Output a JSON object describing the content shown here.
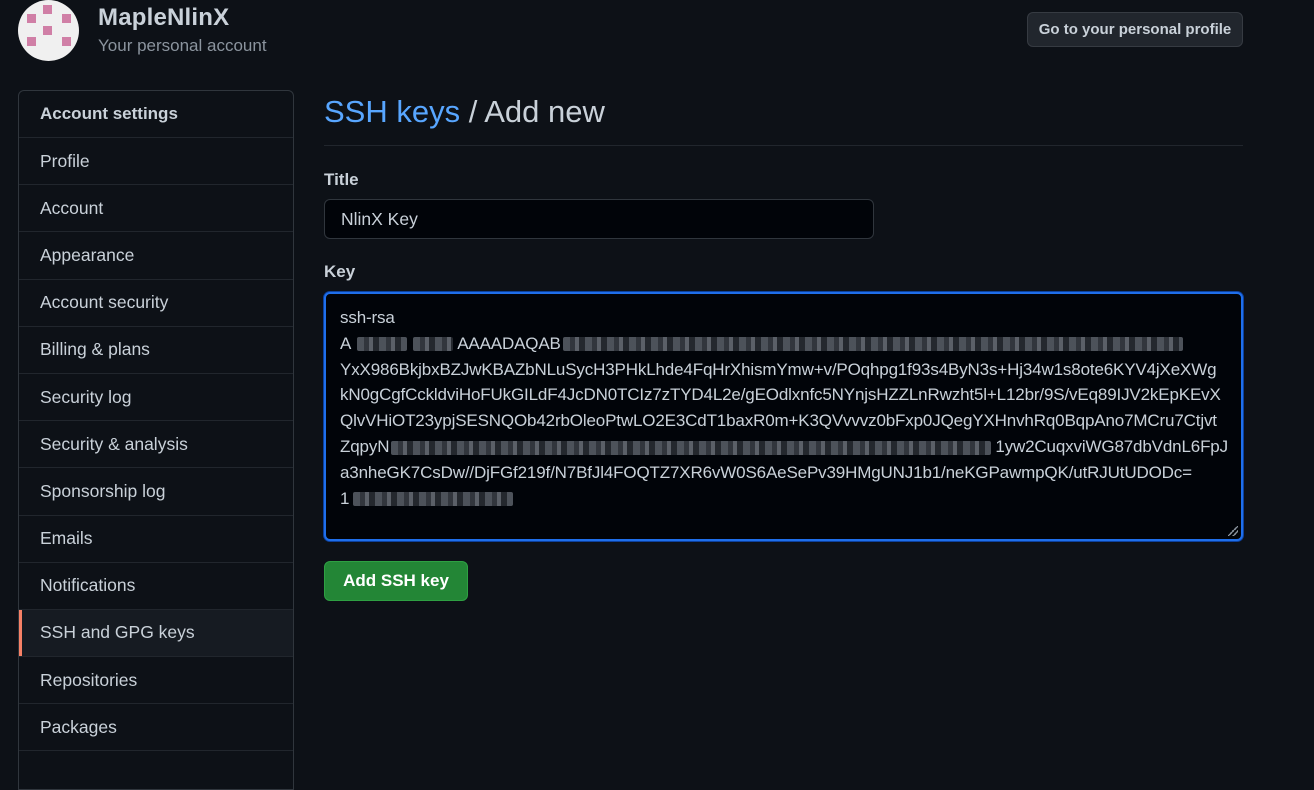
{
  "header": {
    "account_name": "MapleNlinX",
    "account_subtitle": "Your personal account",
    "profile_button": "Go to your personal profile"
  },
  "sidebar": {
    "heading": "Account settings",
    "items": [
      {
        "label": "Profile"
      },
      {
        "label": "Account"
      },
      {
        "label": "Appearance"
      },
      {
        "label": "Account security"
      },
      {
        "label": "Billing & plans"
      },
      {
        "label": "Security log"
      },
      {
        "label": "Security & analysis"
      },
      {
        "label": "Sponsorship log"
      },
      {
        "label": "Emails"
      },
      {
        "label": "Notifications"
      },
      {
        "label": "SSH and GPG keys",
        "active": true
      },
      {
        "label": "Repositories"
      },
      {
        "label": "Packages"
      }
    ]
  },
  "main": {
    "breadcrumb_link": "SSH keys",
    "breadcrumb_separator": " / ",
    "breadcrumb_current": "Add new",
    "title_label": "Title",
    "title_value": "NlinX Key",
    "key_label": "Key",
    "key_lines": [
      "ssh-rsa",
      "A",
      "AAAADAQAB",
      "YxX986BkjbxBZJwKBAZbNLuSycH3PHkLhde4FqHrXhismYmw+v/POqhpg1f93s4ByN3s+Hj34w1s8ote6KYV4jXeXWg",
      "kN0gCgfCckldviHoFUkGILdF4JcDN0TCIz7zTYD4L2e/gEOdlxnfc5NYnjsHZZLnRwzht5l+L12br/9S/vEq89IJV2kEpKEvX",
      "QlvVHiOT23ypjSESNQOb42rbOleoPtwLO2E3CdT1baxR0m+K3QVvvvz0bFxp0JQegYXHnvhRq0BqpAno7MCru7Ctjvt",
      "ZqpyN",
      "1yw2CuqxviWG87dbVdnL6FpJ",
      "a3nheGK7CsDw//DjFGf219f/N7BfJl4FOQTZ7XR6vW0S6AeSePv39HMgUNJ1b1/neKGPawmpQK/utRJUtUDODc=",
      "1"
    ],
    "submit_button": "Add SSH key"
  },
  "colors": {
    "background": "#0d1117",
    "link": "#58a6ff",
    "accent_active": "#f78166",
    "button_green": "#238636",
    "focus_border": "#1f6feb"
  }
}
